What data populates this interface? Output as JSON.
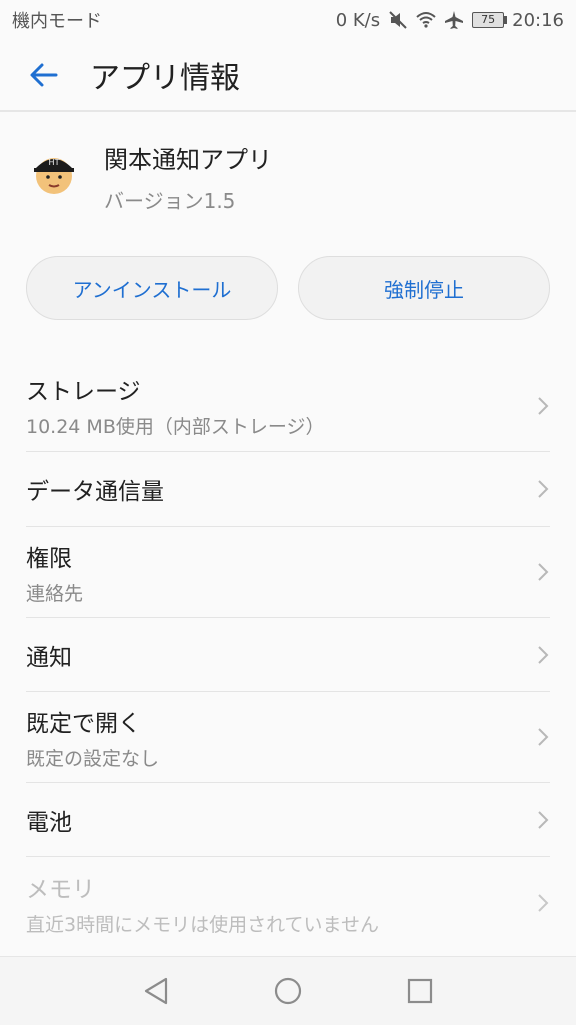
{
  "status": {
    "left": "機内モード",
    "speed": "0 K/s",
    "battery": "75",
    "time": "20:16"
  },
  "appbar": {
    "title": "アプリ情報"
  },
  "app": {
    "name": "関本通知アプリ",
    "version": "バージョン1.5"
  },
  "buttons": {
    "uninstall": "アンインストール",
    "force_stop": "強制停止"
  },
  "list": {
    "storage": {
      "title": "ストレージ",
      "sub": "10.24 MB使用（内部ストレージ）"
    },
    "data": {
      "title": "データ通信量"
    },
    "permissions": {
      "title": "権限",
      "sub": "連絡先"
    },
    "notifications": {
      "title": "通知"
    },
    "open_default": {
      "title": "既定で開く",
      "sub": "既定の設定なし"
    },
    "battery": {
      "title": "電池"
    },
    "memory": {
      "title": "メモリ",
      "sub": "直近3時間にメモリは使用されていません"
    }
  },
  "colors": {
    "accent": "#1f6fd1",
    "background": "#fafafa"
  }
}
